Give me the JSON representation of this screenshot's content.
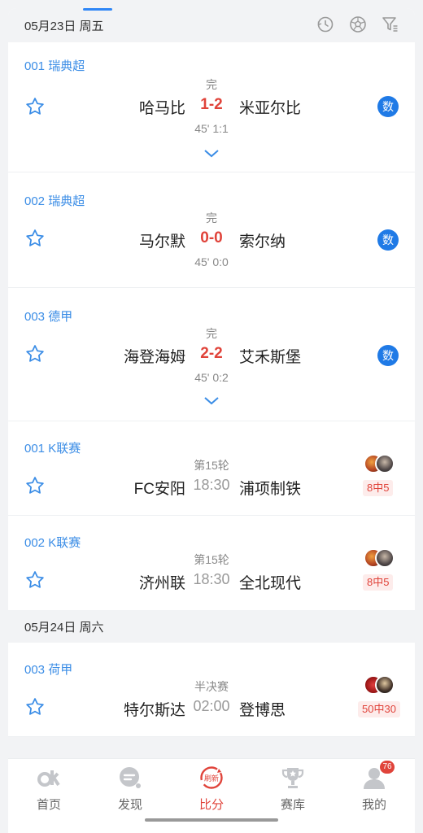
{
  "sections": [
    {
      "date": "05月23日 周五",
      "matches": [
        {
          "league": "001 瑞典超",
          "status": "完",
          "home": "哈马比",
          "score": "1-2",
          "away": "米亚尔比",
          "half": "45' 1:1",
          "badge": "数"
        },
        {
          "league": "002 瑞典超",
          "status": "完",
          "home": "马尔默",
          "score": "0-0",
          "away": "索尔纳",
          "half": "45' 0:0",
          "badge": "数"
        },
        {
          "league": "003 德甲",
          "status": "完",
          "home": "海登海姆",
          "score": "2-2",
          "away": "艾禾斯堡",
          "half": "45' 0:2",
          "badge": "数"
        },
        {
          "league": "001 K联赛",
          "status": "第15轮",
          "home": "FC安阳",
          "time": "18:30",
          "away": "浦项制铁",
          "hit": "8中5"
        },
        {
          "league": "002 K联赛",
          "status": "第15轮",
          "home": "济州联",
          "time": "18:30",
          "away": "全北现代",
          "hit": "8中5"
        }
      ]
    },
    {
      "date": "05月24日 周六",
      "matches": [
        {
          "league": "003 荷甲",
          "status": "半决赛",
          "home": "特尔斯达",
          "time": "02:00",
          "away": "登博思",
          "hit": "50中30"
        }
      ]
    }
  ],
  "icons": {
    "history": "history-icon",
    "ball": "football-icon",
    "filter": "filter-icon",
    "star": "star-icon",
    "expand": "chevron-down-icon"
  },
  "tabbar": {
    "items": [
      {
        "label": "首页",
        "icon": "ok-logo-icon"
      },
      {
        "label": "发现",
        "icon": "discover-icon"
      },
      {
        "label": "比分",
        "icon": "refresh-score-icon",
        "icon_text": "刷新",
        "active": true
      },
      {
        "label": "赛库",
        "icon": "trophy-icon"
      },
      {
        "label": "我的",
        "icon": "user-icon",
        "badge": "76"
      }
    ]
  },
  "colors": {
    "accent": "#e0433a",
    "link": "#3b8de6",
    "badge": "#1f7ae6"
  }
}
